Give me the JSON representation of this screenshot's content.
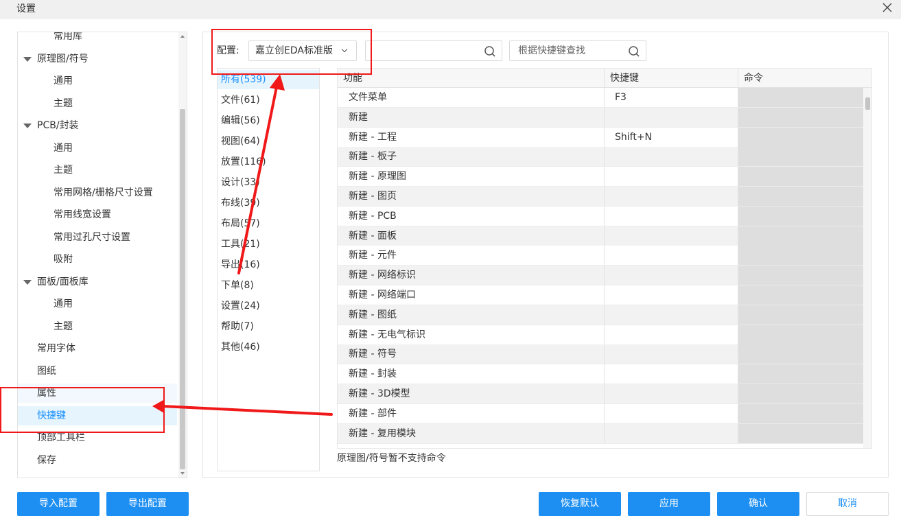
{
  "window": {
    "title": "设置",
    "close_label": "×"
  },
  "left_tree": [
    {
      "label": "常用库",
      "level": 1,
      "state": ""
    },
    {
      "label": "原理图/符号",
      "level": 0,
      "group": true,
      "state": ""
    },
    {
      "label": "通用",
      "level": 1,
      "state": ""
    },
    {
      "label": "主题",
      "level": 1,
      "state": ""
    },
    {
      "label": "PCB/封装",
      "level": 0,
      "group": true,
      "state": ""
    },
    {
      "label": "通用",
      "level": 1,
      "state": ""
    },
    {
      "label": "主题",
      "level": 1,
      "state": ""
    },
    {
      "label": "常用网格/栅格尺寸设置",
      "level": 1,
      "state": ""
    },
    {
      "label": "常用线宽设置",
      "level": 1,
      "state": ""
    },
    {
      "label": "常用过孔尺寸设置",
      "level": 1,
      "state": ""
    },
    {
      "label": "吸附",
      "level": 1,
      "state": ""
    },
    {
      "label": "面板/面板库",
      "level": 0,
      "group": true,
      "state": ""
    },
    {
      "label": "通用",
      "level": 1,
      "state": ""
    },
    {
      "label": "主题",
      "level": 1,
      "state": ""
    },
    {
      "label": "常用字体",
      "level": 0,
      "state": ""
    },
    {
      "label": "图纸",
      "level": 0,
      "state": ""
    },
    {
      "label": "属性",
      "level": 0,
      "state": "hover"
    },
    {
      "label": "快捷键",
      "level": 0,
      "state": "selected"
    },
    {
      "label": "顶部工具栏",
      "level": 0,
      "state": ""
    },
    {
      "label": "保存",
      "level": 0,
      "state": ""
    }
  ],
  "config": {
    "label": "配置:",
    "selected": "嘉立创EDA标准版"
  },
  "search": {
    "func_value": "",
    "func_placeholder": "",
    "shortcut_placeholder": "根据快捷键查找"
  },
  "categories": [
    {
      "label": "所有(539)",
      "active": true
    },
    {
      "label": "文件(61)"
    },
    {
      "label": "编辑(56)"
    },
    {
      "label": "视图(64)"
    },
    {
      "label": "放置(116)"
    },
    {
      "label": "设计(33)"
    },
    {
      "label": "布线(39)"
    },
    {
      "label": "布局(57)"
    },
    {
      "label": "工具(21)"
    },
    {
      "label": "导出(16)"
    },
    {
      "label": "下单(8)"
    },
    {
      "label": "设置(24)"
    },
    {
      "label": "帮助(7)"
    },
    {
      "label": "其他(46)"
    }
  ],
  "table": {
    "headers": [
      "功能",
      "快捷键",
      "命令"
    ],
    "rows": [
      [
        "文件菜单",
        "F3",
        ""
      ],
      [
        "新建",
        "",
        ""
      ],
      [
        "新建 - 工程",
        "Shift+N",
        ""
      ],
      [
        "新建 - 板子",
        "",
        ""
      ],
      [
        "新建 - 原理图",
        "",
        ""
      ],
      [
        "新建 - 图页",
        "",
        ""
      ],
      [
        "新建 - PCB",
        "",
        ""
      ],
      [
        "新建 - 面板",
        "",
        ""
      ],
      [
        "新建 - 元件",
        "",
        ""
      ],
      [
        "新建 - 网络标识",
        "",
        ""
      ],
      [
        "新建 - 网络端口",
        "",
        ""
      ],
      [
        "新建 - 图纸",
        "",
        ""
      ],
      [
        "新建 - 无电气标识",
        "",
        ""
      ],
      [
        "新建 - 符号",
        "",
        ""
      ],
      [
        "新建 - 封装",
        "",
        ""
      ],
      [
        "新建 - 3D模型",
        "",
        ""
      ],
      [
        "新建 - 部件",
        "",
        ""
      ],
      [
        "新建 - 复用模块",
        "",
        ""
      ]
    ]
  },
  "note": "原理图/符号暂不支持命令",
  "buttons": {
    "import": "导入配置",
    "export": "导出配置",
    "restore": "恢复默认",
    "apply": "应用",
    "confirm": "确认",
    "cancel": "取消"
  },
  "colors": {
    "primary": "#1e8ff2",
    "selected_bg": "#e6f4fd",
    "annotation_red": "#f01818"
  }
}
